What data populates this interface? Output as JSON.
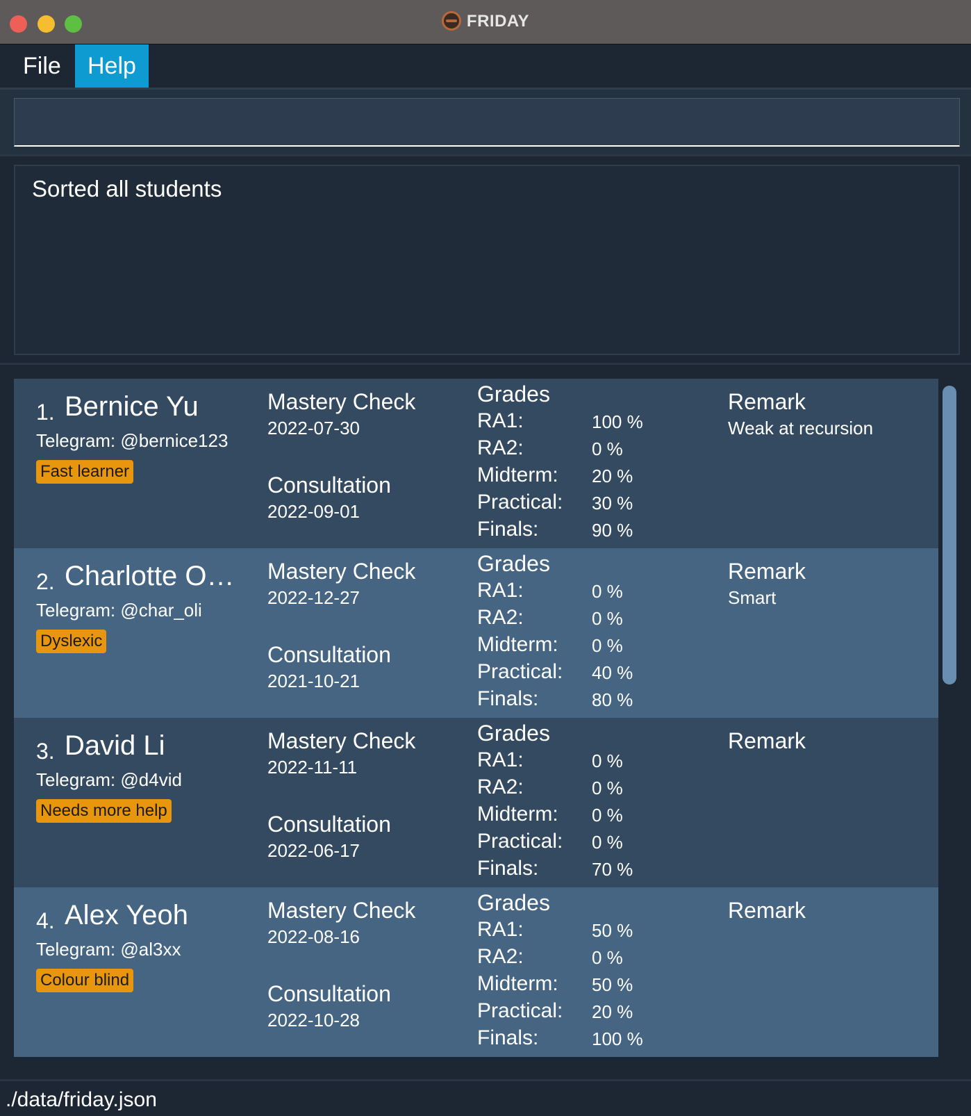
{
  "window": {
    "title": "FRIDAY"
  },
  "menu": {
    "file_label": "File",
    "help_label": "Help"
  },
  "command": {
    "value": ""
  },
  "result": {
    "text": "Sorted all students"
  },
  "grade_labels": {
    "ra1": "RA1:",
    "ra2": "RA2:",
    "midterm": "Midterm:",
    "practical": "Practical:",
    "finals": "Finals:"
  },
  "students": [
    {
      "index": "1.",
      "name": "Bernice Yu",
      "telegram": "Telegram: @bernice123",
      "tag": "Fast learner",
      "mastery_label": "Mastery Check",
      "mastery_date": "2022-07-30",
      "consultation_label": "Consultation",
      "consultation_date": "2022-09-01",
      "grades_label": "Grades",
      "grades": {
        "ra1": "100 %",
        "ra2": "0 %",
        "midterm": "20 %",
        "practical": "30 %",
        "finals": "90 %"
      },
      "remark_label": "Remark",
      "remark": "Weak at recursion"
    },
    {
      "index": "2.",
      "name": "Charlotte Oli...",
      "telegram": "Telegram: @char_oli",
      "tag": "Dyslexic",
      "mastery_label": "Mastery Check",
      "mastery_date": "2022-12-27",
      "consultation_label": "Consultation",
      "consultation_date": "2021-10-21",
      "grades_label": "Grades",
      "grades": {
        "ra1": "0 %",
        "ra2": "0 %",
        "midterm": "0 %",
        "practical": "40 %",
        "finals": "80 %"
      },
      "remark_label": "Remark",
      "remark": "Smart"
    },
    {
      "index": "3.",
      "name": "David Li",
      "telegram": "Telegram: @d4vid",
      "tag": "Needs more help",
      "mastery_label": "Mastery Check",
      "mastery_date": "2022-11-11",
      "consultation_label": "Consultation",
      "consultation_date": "2022-06-17",
      "grades_label": "Grades",
      "grades": {
        "ra1": "0 %",
        "ra2": "0 %",
        "midterm": "0 %",
        "practical": "0 %",
        "finals": "70 %"
      },
      "remark_label": "Remark",
      "remark": ""
    },
    {
      "index": "4.",
      "name": "Alex Yeoh",
      "telegram": "Telegram: @al3xx",
      "tag": "Colour blind",
      "mastery_label": "Mastery Check",
      "mastery_date": "2022-08-16",
      "consultation_label": "Consultation",
      "consultation_date": "2022-10-28",
      "grades_label": "Grades",
      "grades": {
        "ra1": "50 %",
        "ra2": "0 %",
        "midterm": "50 %",
        "practical": "20 %",
        "finals": "100 %"
      },
      "remark_label": "Remark",
      "remark": ""
    }
  ],
  "status": {
    "file_path": "./data/friday.json"
  },
  "colors": {
    "accent": "#0e9bd2",
    "tag": "#e8960e",
    "card_odd": "#344a60",
    "card_even": "#456583",
    "background": "#1d2733"
  }
}
